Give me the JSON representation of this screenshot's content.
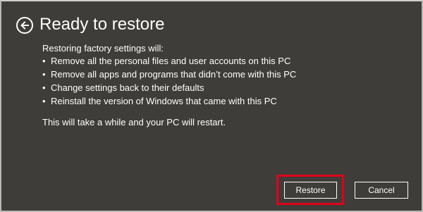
{
  "dialog": {
    "title": "Ready to restore",
    "back_icon": "back-arrow-icon",
    "intro": "Restoring factory settings will:",
    "bullet_char": "•",
    "bullets": [
      "Remove all the personal files and user accounts on this PC",
      "Remove all apps and programs that didn’t come with this PC",
      "Change settings back to their defaults",
      "Reinstall the version of Windows that came with this PC"
    ],
    "note": "This will take a while and your PC will restart.",
    "buttons": {
      "restore": "Restore",
      "cancel": "Cancel"
    }
  },
  "colors": {
    "background": "#3e3d39",
    "text": "#ffffff",
    "highlight": "#e0001b"
  }
}
